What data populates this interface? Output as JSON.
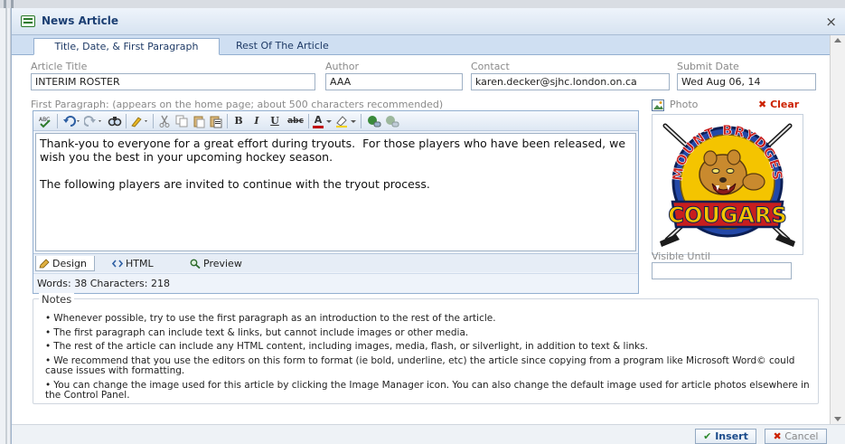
{
  "window": {
    "title": "News Article",
    "close_glyph": "×"
  },
  "tabs": [
    {
      "label": "Title, Date, & First Paragraph",
      "active": true
    },
    {
      "label": "Rest Of The Article",
      "active": false
    }
  ],
  "fields": {
    "article_title": {
      "label": "Article Title",
      "value": "INTERIM ROSTER"
    },
    "author": {
      "label": "Author",
      "value": "AAA"
    },
    "contact": {
      "label": "Contact",
      "value": "karen.decker@sjhc.london.on.ca"
    },
    "submit_date": {
      "label": "Submit Date",
      "value": "Wed Aug 06, 14"
    }
  },
  "first_paragraph": {
    "label": "First Paragraph: (appears on the home page; about 500 characters recommended)",
    "content": "Thank-you to everyone for a great effort during tryouts.  For those players who have been released, we wish you the best in your upcoming hockey season.\n\nThe following players are invited to continue with the tryout process.",
    "toolbar": {
      "bold": "B",
      "italic": "I",
      "underline": "U",
      "strike": "abc",
      "font_color": "A"
    }
  },
  "editor_modes": [
    {
      "label": "Design",
      "active": true
    },
    {
      "label": "HTML",
      "active": false
    },
    {
      "label": "Preview",
      "active": false
    }
  ],
  "counts": "Words: 38   Characters: 218",
  "photo": {
    "label": "Photo",
    "clear_label": "Clear",
    "logo_top_text": "MOUNT BRYDGES",
    "logo_bottom_text": "COUGARS"
  },
  "visible_until": {
    "label": "Visible Until",
    "value": ""
  },
  "notes": {
    "legend": "Notes",
    "items": [
      "Whenever possible, try to use the first paragraph as an introduction to the rest of the article.",
      "The first paragraph can include text & links, but cannot include images or other media.",
      "The rest of the article can include any HTML content, including images, media, flash, or silverlight, in addition to text & links.",
      "We recommend that you use the editors on this form to format (ie bold, underline, etc) the article since copying from a program like Microsoft Word© could cause issues with formatting.",
      "You can change the image used for this article by clicking the Image Manager icon. You can also change the default image used for article photos elsewhere in the Control Panel."
    ]
  },
  "buttons": {
    "insert": "Insert",
    "cancel": "Cancel"
  },
  "colors": {
    "accent": "#1c3f73",
    "clear_red": "#cc2200",
    "insert_green": "#2d8a2d"
  }
}
